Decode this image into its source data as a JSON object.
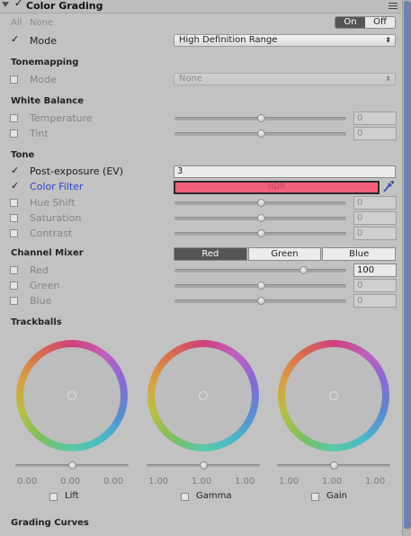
{
  "header": {
    "title": "Color Grading",
    "enabled": true
  },
  "presets": {
    "all": "All",
    "none": "None"
  },
  "toggle": {
    "on": "On",
    "off": "Off"
  },
  "mode": {
    "label": "Mode",
    "checked": true,
    "value": "High Definition Range"
  },
  "tonemapping": {
    "section": "Tonemapping",
    "mode_label": "Mode",
    "mode_value": "None"
  },
  "white_balance": {
    "section": "White Balance",
    "rows": [
      {
        "label": "Temperature",
        "value": "0",
        "position": 0.5
      },
      {
        "label": "Tint",
        "value": "0",
        "position": 0.5
      }
    ]
  },
  "tone": {
    "section": "Tone",
    "post_exposure": {
      "label": "Post-exposure (EV)",
      "value": "3"
    },
    "color_filter": {
      "label": "Color Filter",
      "hdr": "HDR",
      "color": "#f06077"
    },
    "rows": [
      {
        "label": "Hue Shift",
        "value": "0",
        "position": 0.5
      },
      {
        "label": "Saturation",
        "value": "0",
        "position": 0.5
      },
      {
        "label": "Contrast",
        "value": "0",
        "position": 0.5
      }
    ]
  },
  "channel_mixer": {
    "section": "Channel Mixer",
    "tabs": [
      "Red",
      "Green",
      "Blue"
    ],
    "selected_tab": "Red",
    "rows": [
      {
        "label": "Red",
        "value": "100",
        "position": 0.75
      },
      {
        "label": "Green",
        "value": "0",
        "position": 0.5
      },
      {
        "label": "Blue",
        "value": "0",
        "position": 0.5
      }
    ]
  },
  "trackballs": {
    "section": "Trackballs",
    "wheels": [
      {
        "label": "Lift",
        "values": [
          "0.00",
          "0.00",
          "0.00"
        ],
        "position": 0.5
      },
      {
        "label": "Gamma",
        "values": [
          "1.00",
          "1.00",
          "1.00"
        ],
        "position": 0.5
      },
      {
        "label": "Gain",
        "values": [
          "1.00",
          "1.00",
          "1.00"
        ],
        "position": 0.5
      }
    ]
  },
  "grading_curves": {
    "section": "Grading Curves"
  },
  "colors": {
    "accent": "#555555",
    "label_blue": "#2b44c8",
    "scroll_thumb": "#6b84b4"
  }
}
